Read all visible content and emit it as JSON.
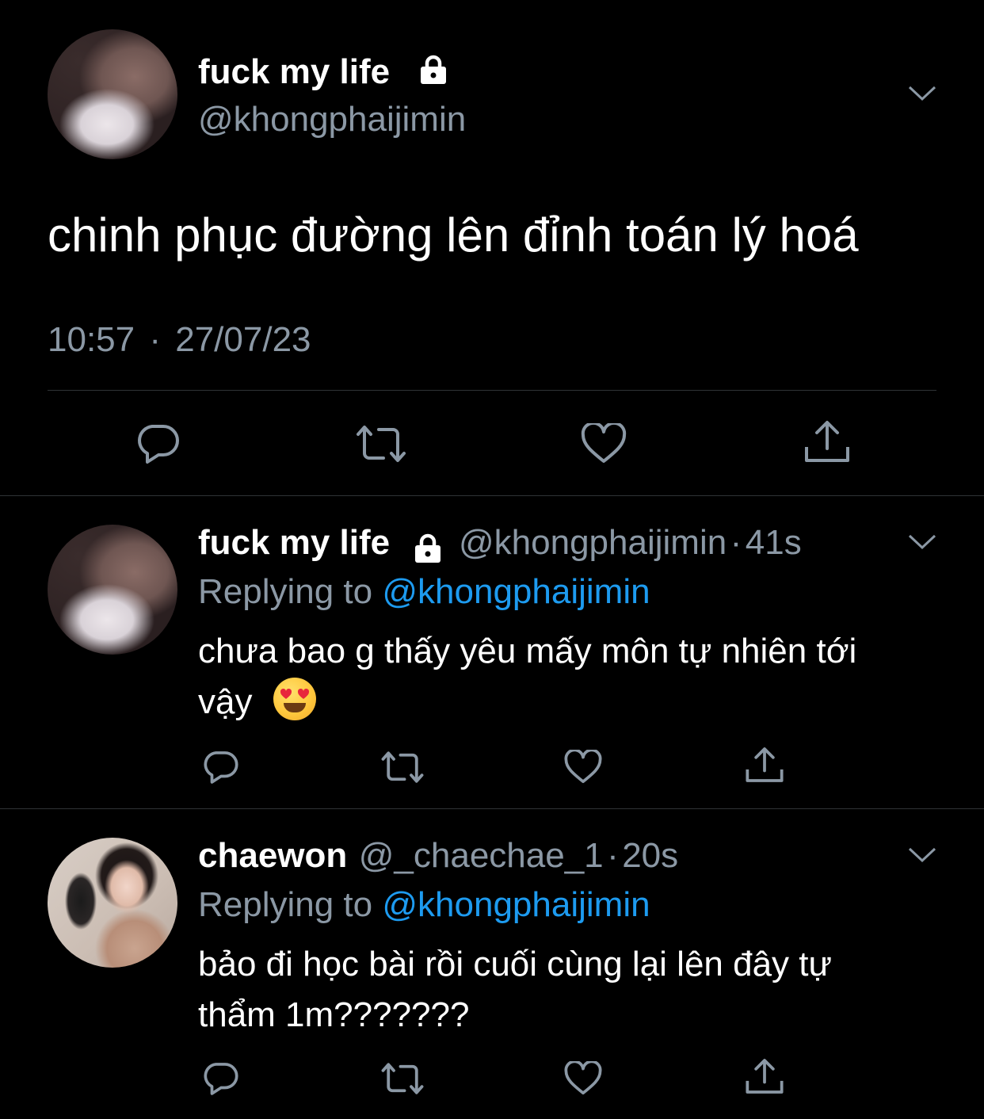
{
  "main_tweet": {
    "display_name": "fuck my life",
    "handle": "@khongphaijimin",
    "text": "chinh phục đường lên đỉnh toán lý hoá",
    "time": "10:57",
    "separator": "·",
    "date": "27/07/23"
  },
  "replies": [
    {
      "display_name": "fuck my life",
      "handle": "@khongphaijimin",
      "dot": "·",
      "age": "41s",
      "replying_label": "Replying to",
      "replying_to": "@khongphaijimin",
      "text_line1": "chưa bao g thấy yêu mấy môn tự nhiên tới",
      "text_line2": "vậy",
      "emoji": "smiling-face-with-heart-eyes"
    },
    {
      "display_name": "chaewon",
      "handle": "@_chaechae_1",
      "dot": "·",
      "age": "20s",
      "replying_label": "Replying to",
      "replying_to": "@khongphaijimin",
      "text_line1": "bảo đi học bài rồi cuối cùng lại lên đây tự",
      "text_line2": "thẩm 1m???????"
    }
  ],
  "icons": {
    "reply": "reply-icon",
    "retweet": "retweet-icon",
    "like": "like-icon",
    "share": "share-icon",
    "lock": "lock-icon",
    "caret": "chevron-down-icon"
  },
  "colors": {
    "background": "#000000",
    "text": "#ffffff",
    "secondary": "#8b98a5",
    "link": "#1d9bf0",
    "divider": "#2f3336"
  }
}
